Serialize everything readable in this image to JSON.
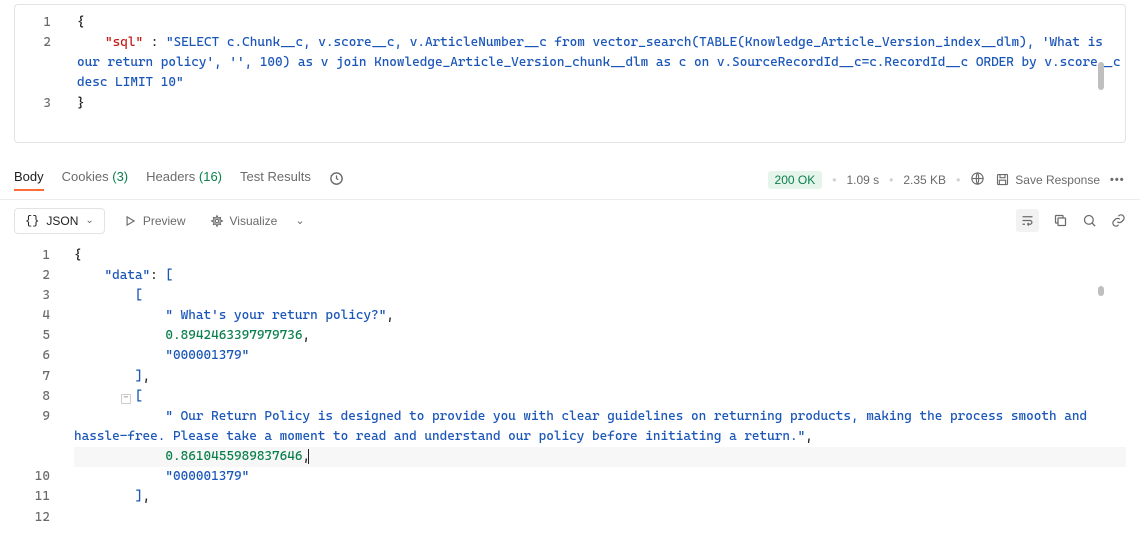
{
  "request": {
    "lines": [
      {
        "n": 1,
        "type": "brace",
        "text": "{"
      },
      {
        "n": 2,
        "type": "kv",
        "key": "\"sql\"",
        "sep": " : ",
        "value": "\"SELECT c.Chunk__c, v.score__c, v.ArticleNumber__c from vector_search(TABLE(Knowledge_Article_Version_index__dlm), 'What is our return policy', '', 100) as v join Knowledge_Article_Version_chunk__dlm as c on v.SourceRecordId__c=c.RecordId__c ORDER by v.score__c desc LIMIT 10\""
      },
      {
        "n": 3,
        "type": "brace",
        "text": "}"
      }
    ]
  },
  "tabs": {
    "body": "Body",
    "cookies": "Cookies",
    "cookies_count": "(3)",
    "headers": "Headers",
    "headers_count": "(16)",
    "test_results": "Test Results"
  },
  "meta": {
    "status": "200 OK",
    "time": "1.09 s",
    "size": "2.35 KB",
    "save": "Save Response"
  },
  "toolbar": {
    "format": "JSON",
    "preview": "Preview",
    "visualize": "Visualize"
  },
  "response": {
    "lines": [
      {
        "n": 1,
        "text": "{"
      },
      {
        "n": 2,
        "text_html": "    <span class='r-key'>\"data\"</span><span class='r-punc'>:</span> <span class='r-bracket'>[</span>"
      },
      {
        "n": 3,
        "text_html": "        <span class='r-bracket'>[</span>"
      },
      {
        "n": 4,
        "text_html": "            <span class='r-str'>\" What's your return policy?\"</span><span class='r-punc'>,</span>"
      },
      {
        "n": 5,
        "text_html": "            <span class='r-num'>0.8942463397979736</span><span class='r-punc'>,</span>"
      },
      {
        "n": 6,
        "text_html": "            <span class='r-str'>\"000001379\"</span>"
      },
      {
        "n": 7,
        "text_html": "        <span class='r-bracket'>]</span><span class='r-punc'>,</span>"
      },
      {
        "n": 8,
        "text_html": "        <span class='fold'>−</span><span class='r-bracket'>[</span>"
      },
      {
        "n": 9,
        "text_html": "            <span class='r-str'>\" Our Return Policy is designed to provide you with clear guidelines on returning products, making the process smooth and hassle-free. Please take a moment to read and understand our policy before initiating a return.\"</span><span class='r-punc'>,</span>"
      },
      {
        "n": 10,
        "highlight": true,
        "text_html": "            <span class='r-num'>0.8610455989837646</span><span class='r-punc'>,</span><span class='cursor'></span>"
      },
      {
        "n": 11,
        "text_html": "            <span class='r-str'>\"000001379\"</span>"
      },
      {
        "n": 12,
        "text_html": "        <span class='r-bracket'>]</span><span class='r-punc'>,</span>"
      }
    ]
  }
}
